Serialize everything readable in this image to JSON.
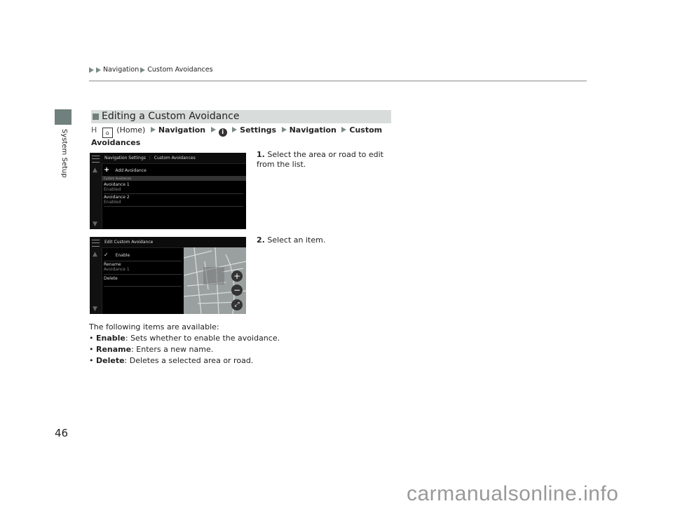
{
  "breadcrumb": [
    "Navigation",
    "Custom Avoidances"
  ],
  "side_tab": "System Setup",
  "section": {
    "title": "Editing a Custom Avoidance"
  },
  "path": {
    "prefix_symbol": "H",
    "home_label": "(Home)",
    "steps": [
      "Navigation",
      "Settings",
      "Navigation",
      "Custom Avoidances"
    ]
  },
  "screen1": {
    "title_left": "Navigation Settings",
    "title_right": "Custom Avoidances",
    "add_label": "Add Avoidance",
    "group_label": "Custom Avoidances",
    "items": [
      {
        "name": "Avoidance 1",
        "status": "Enabled"
      },
      {
        "name": "Avoidance 2",
        "status": "Enabled"
      }
    ]
  },
  "screen2": {
    "title": "Edit Custom Avoidance",
    "enable_label": "Enable",
    "rename_label": "Rename",
    "rename_value": "Avoidance 1",
    "delete_label": "Delete"
  },
  "steps": [
    {
      "num": "1.",
      "text": "Select the area or road to edit from the list."
    },
    {
      "num": "2.",
      "text": "Select an item."
    }
  ],
  "available": {
    "intro": "The following items are available:",
    "items": [
      {
        "term": "Enable",
        "desc": ": Sets whether to enable the avoidance."
      },
      {
        "term": "Rename",
        "desc": ": Enters a new name."
      },
      {
        "term": "Delete",
        "desc": ": Deletes a selected area or road."
      }
    ]
  },
  "page_number": "46",
  "watermark": "carmanualsonline.info"
}
